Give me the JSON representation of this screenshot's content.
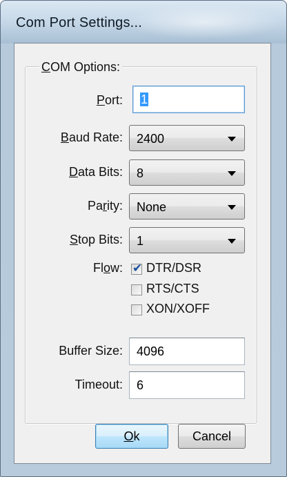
{
  "window": {
    "title": "Com Port Settings..."
  },
  "group": {
    "legend_prefix": "C",
    "legend_rest": "OM Options:"
  },
  "port": {
    "label_u": "P",
    "label_rest": "ort:",
    "value": "1"
  },
  "baud_rate": {
    "label_u": "B",
    "label_rest": "aud Rate:",
    "value": "2400"
  },
  "data_bits": {
    "label_u": "D",
    "label_rest": "ata Bits:",
    "value": "8"
  },
  "parity": {
    "label_pre": "Pa",
    "label_u": "r",
    "label_rest": "ity:",
    "value": "None"
  },
  "stop_bits": {
    "label_u": "S",
    "label_rest": "top Bits:",
    "value": "1"
  },
  "flow": {
    "label_pre": "Fl",
    "label_u": "o",
    "label_rest": "w:",
    "options": [
      {
        "label": "DTR/DSR",
        "checked": true
      },
      {
        "label": "RTS/CTS",
        "checked": false
      },
      {
        "label": "XON/XOFF",
        "checked": false
      }
    ]
  },
  "buffer_size": {
    "label": "Buffer Size:",
    "value": "4096"
  },
  "timeout": {
    "label": "Timeout:",
    "value": "6"
  },
  "buttons": {
    "ok_u": "O",
    "ok_rest": "k",
    "cancel": "Cancel"
  },
  "colors": {
    "accent": "#3c7fb1",
    "check": "#1b4f9c",
    "selection": "#3399ff"
  }
}
